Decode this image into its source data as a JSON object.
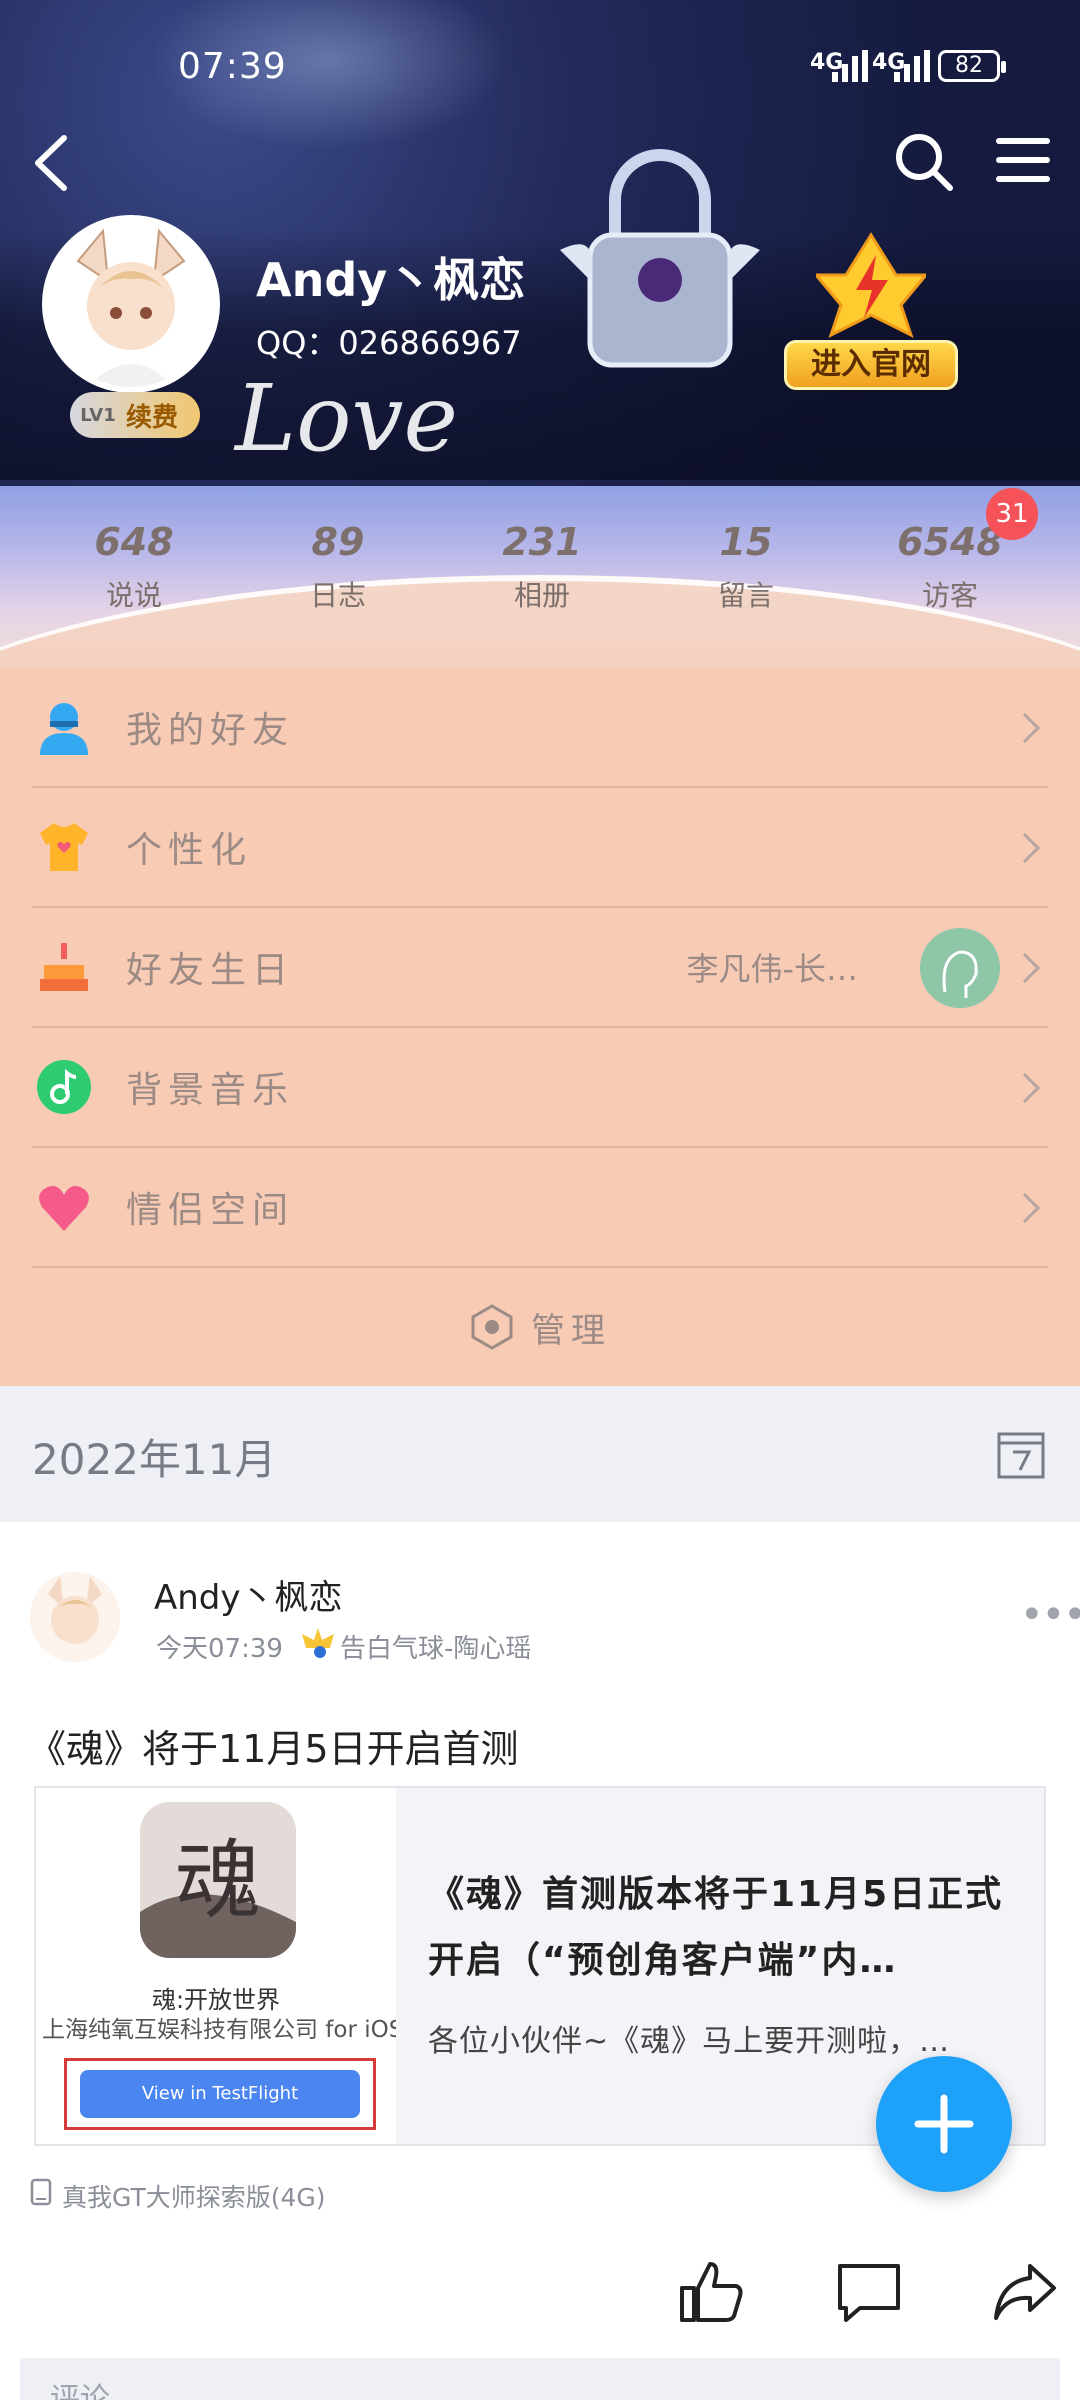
{
  "status_bar": {
    "time": "07:39",
    "network1": "4G",
    "network2": "4G",
    "battery": "82"
  },
  "profile": {
    "name": "Andy丶枫恋",
    "qq": "QQ：026866967",
    "level": "LV1",
    "renew": "续费",
    "official_site": "进入官网",
    "banner_text": "Love"
  },
  "stats": [
    {
      "value": "648",
      "label": "说说"
    },
    {
      "value": "89",
      "label": "日志"
    },
    {
      "value": "231",
      "label": "相册"
    },
    {
      "value": "15",
      "label": "留言"
    },
    {
      "value": "6548",
      "label": "访客"
    }
  ],
  "visitor_badge": "31",
  "menu": {
    "items": [
      {
        "label": "我的好友",
        "icon": "friend-icon"
      },
      {
        "label": "个性化",
        "icon": "shirt-icon"
      },
      {
        "label": "好友生日",
        "icon": "cake-icon",
        "extra": "李凡伟-长…"
      },
      {
        "label": "背景音乐",
        "icon": "music-icon"
      },
      {
        "label": "情侣空间",
        "icon": "heart-icon"
      }
    ],
    "manage": "管理"
  },
  "date_header": "2022年11月",
  "post": {
    "author": "Andy丶枫恋",
    "time": "今天07:39",
    "music": "告白气球-陶心瑶",
    "text": "《魂》将于11月5日开启首测",
    "card": {
      "app_icon_char": "魂",
      "app_name": "魂:开放世界",
      "app_company": "上海纯氧互娱科技有限公司 for iOS",
      "testflight": "View in TestFlight",
      "title": "《魂》首测版本将于11月5日正式开启（“预创角客户端”内…",
      "desc": "各位小伙伴~《魂》马上要开测啦，…"
    },
    "device": "真我GT大师探索版(4G)",
    "comment_placeholder": "评论"
  },
  "colors": {
    "menu_bg": "#f8cbb4",
    "fab": "#1ea1f9",
    "badge": "#f5525a"
  }
}
